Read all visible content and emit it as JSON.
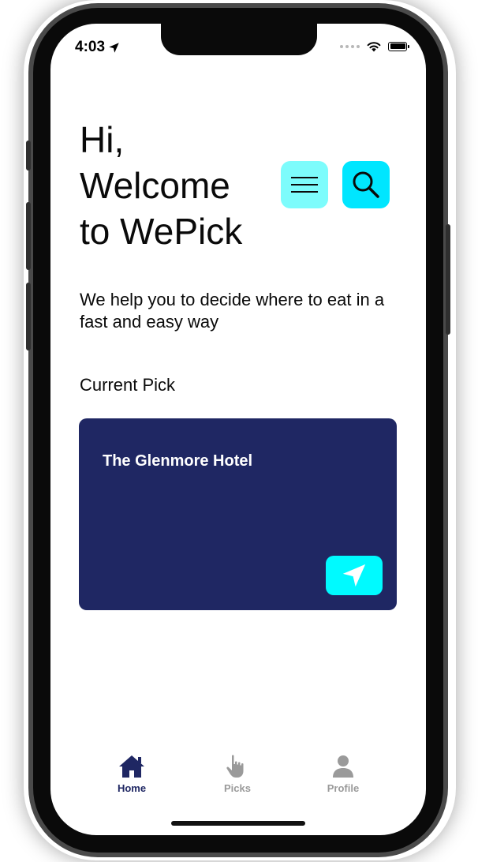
{
  "status_bar": {
    "time": "4:03"
  },
  "header": {
    "greeting_lines": [
      "Hi,",
      "Welcome",
      "to WePick"
    ],
    "menu_icon": "hamburger-menu-icon",
    "search_icon": "search-icon"
  },
  "tagline": "We help you to decide where to eat in a fast and easy way",
  "current_pick": {
    "section_label": "Current Pick",
    "name": "The Glenmore Hotel",
    "navigate_icon": "location-arrow-icon"
  },
  "tabbar": {
    "tabs": [
      {
        "label": "Home",
        "icon": "home-icon",
        "active": true
      },
      {
        "label": "Picks",
        "icon": "hand-pointer-icon",
        "active": false
      },
      {
        "label": "Profile",
        "icon": "user-icon",
        "active": false
      }
    ]
  },
  "colors": {
    "card_background": "#1f2763",
    "menu_button": "#7dfcfc",
    "search_button": "#00e6ff",
    "nav_button": "#00faff",
    "tab_active": "#1f2763",
    "tab_inactive": "#9a9a9a"
  }
}
